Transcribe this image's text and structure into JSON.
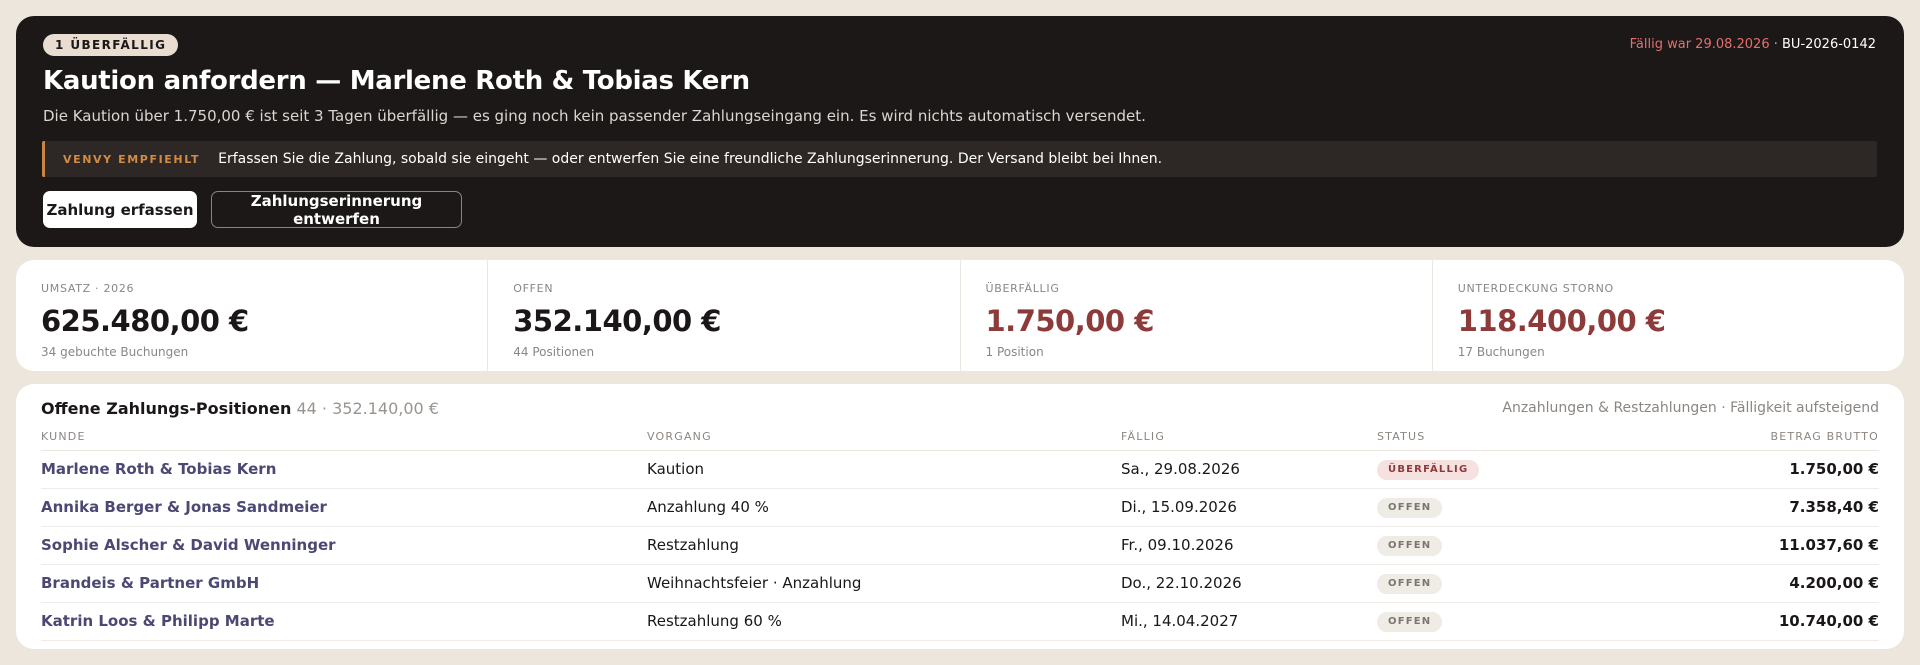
{
  "alert": {
    "badge": "1 ÜBERFÄLLIG",
    "due_text": "Fällig war 29.08.2026",
    "meta_separator": " · ",
    "booking_id": "BU-2026-0142",
    "title": "Kaution anfordern — Marlene Roth & Tobias Kern",
    "description": "Die Kaution über 1.750,00 € ist seit 3 Tagen überfällig — es ging noch kein passender Zahlungseingang ein. Es wird nichts automatisch versendet.",
    "recommendation_label": "VENVY EMPFIEHLT",
    "recommendation_text": "Erfassen Sie die Zahlung, sobald sie eingeht — oder entwerfen Sie eine freundliche Zahlungserinnerung. Der Versand bleibt bei Ihnen.",
    "primary_button": "Zahlung erfassen",
    "secondary_button": "Zahlungserinnerung entwerfen"
  },
  "kpis": [
    {
      "label": "UMSATZ · 2026",
      "value": "625.480,00 €",
      "note": "34 gebuchte Buchungen"
    },
    {
      "label": "OFFEN",
      "value": "352.140,00 €",
      "note": "44 Positionen"
    },
    {
      "label": "ÜBERFÄLLIG",
      "value": "1.750,00 €",
      "note": "1 Position"
    },
    {
      "label": "UNTERDECKUNG STORNO",
      "value": "118.400,00 €",
      "note": "17 Buchungen"
    }
  ],
  "table": {
    "title": "Offene Zahlungs-Positionen",
    "count": " 44 · 352.140,00 €",
    "subtitle": "Anzahlungen & Restzahlungen · Fälligkeit aufsteigend",
    "columns": [
      "KUNDE",
      "VORGANG",
      "FÄLLIG",
      "STATUS",
      "BETRAG BRUTTO"
    ],
    "rows": [
      {
        "kunde": "Marlene Roth & Tobias Kern",
        "vorgang": "Kaution",
        "faellig": "Sa., 29.08.2026",
        "status": "ÜBERFÄLLIG",
        "betrag": "1.750,00 €"
      },
      {
        "kunde": "Annika Berger & Jonas Sandmeier",
        "vorgang": "Anzahlung 40 %",
        "faellig": "Di., 15.09.2026",
        "status": "OFFEN",
        "betrag": "7.358,40 €"
      },
      {
        "kunde": "Sophie Alscher & David Wenninger",
        "vorgang": "Restzahlung",
        "faellig": "Fr., 09.10.2026",
        "status": "OFFEN",
        "betrag": "11.037,60 €"
      },
      {
        "kunde": "Brandeis & Partner GmbH",
        "vorgang": "Weihnachtsfeier · Anzahlung",
        "faellig": "Do., 22.10.2026",
        "status": "OFFEN",
        "betrag": "4.200,00 €"
      },
      {
        "kunde": "Katrin Loos & Philipp Marte",
        "vorgang": "Restzahlung 60 %",
        "faellig": "Mi., 14.04.2027",
        "status": "OFFEN",
        "betrag": "10.740,00 €"
      }
    ]
  },
  "colors": {
    "dark_card": "#1b1817",
    "accent_orange": "#d28b45",
    "overdue_red": "#8d3b3a",
    "customer_link": "#4b4873",
    "background": "#ece6dd"
  }
}
